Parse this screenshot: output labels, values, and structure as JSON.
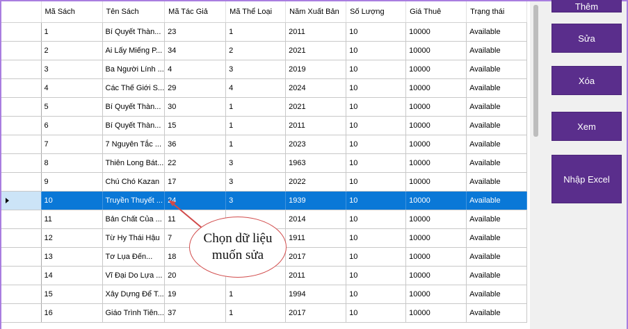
{
  "grid": {
    "columns": [
      "Mã Sách",
      "Tên Sách",
      "Mã Tác Giả",
      "Mã Thể Loại",
      "Năm Xuất Bản",
      "Số Lượng",
      "Giá Thuê",
      "Trạng thái"
    ],
    "selected_row": 9,
    "rows": [
      [
        "1",
        "Bí Quyết Thàn...",
        "23",
        "1",
        "2011",
        "10",
        "10000",
        "Available"
      ],
      [
        "2",
        "Ai Lấy Miếng P...",
        "34",
        "2",
        "2021",
        "10",
        "10000",
        "Available"
      ],
      [
        "3",
        "Ba Người Lính ...",
        "4",
        "3",
        "2019",
        "10",
        "10000",
        "Available"
      ],
      [
        "4",
        "Các Thế Giới S...",
        "29",
        "4",
        "2024",
        "10",
        "10000",
        "Available"
      ],
      [
        "5",
        "Bí Quyết Thàn...",
        "30",
        "1",
        "2021",
        "10",
        "10000",
        "Available"
      ],
      [
        "6",
        "Bí Quyết Thàn...",
        "15",
        "1",
        "2011",
        "10",
        "10000",
        "Available"
      ],
      [
        "7",
        "7 Nguyên Tắc ...",
        "36",
        "1",
        "2023",
        "10",
        "10000",
        "Available"
      ],
      [
        "8",
        "Thiên Long Bát...",
        "22",
        "3",
        "1963",
        "10",
        "10000",
        "Available"
      ],
      [
        "9",
        "Chú Chó Kazan",
        "17",
        "3",
        "2022",
        "10",
        "10000",
        "Available"
      ],
      [
        "10",
        "Truyền Thuyết ...",
        "24",
        "3",
        "1939",
        "10",
        "10000",
        "Available"
      ],
      [
        "11",
        "Bản Chất Của ...",
        "11",
        "",
        "2014",
        "10",
        "10000",
        "Available"
      ],
      [
        "12",
        "Từ Hy Thái Hậu",
        "7",
        "",
        "1911",
        "10",
        "10000",
        "Available"
      ],
      [
        "13",
        "Tơ Lụa Đến...",
        "18",
        "",
        "2017",
        "10",
        "10000",
        "Available"
      ],
      [
        "14",
        "Vĩ Đại Do Lựa ...",
        "20",
        "",
        "2011",
        "10",
        "10000",
        "Available"
      ],
      [
        "15",
        "Xây Dựng Để T...",
        "19",
        "1",
        "1994",
        "10",
        "10000",
        "Available"
      ],
      [
        "16",
        "Giáo Trình Tiên...",
        "37",
        "1",
        "2017",
        "10",
        "10000",
        "Available"
      ]
    ]
  },
  "buttons": {
    "top_partial": "Thêm",
    "edit": "Sửa",
    "delete": "Xóa",
    "view": "Xem",
    "import_excel": "Nhập Excel"
  },
  "annotation": {
    "line1": "Chọn dữ liệu",
    "line2": "muốn sửa"
  },
  "colors": {
    "button_bg": "#5a2e8c",
    "selected_row_bg": "#0a78d7",
    "annotation_stroke": "#d14a4a"
  }
}
